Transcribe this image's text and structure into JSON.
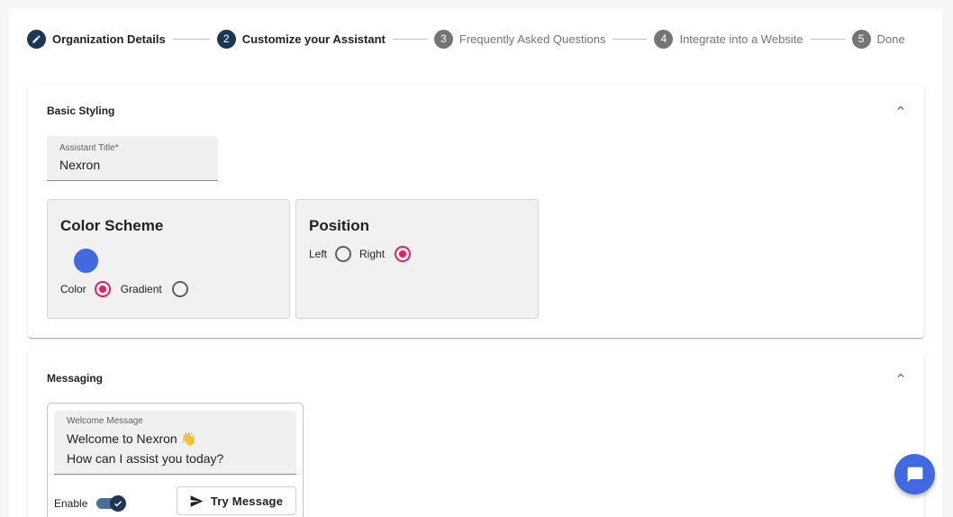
{
  "stepper": {
    "steps": [
      {
        "number": "",
        "label": "Organization Details",
        "state": "completed",
        "icon": "pencil-icon"
      },
      {
        "number": "2",
        "label": "Customize your Assistant",
        "state": "active"
      },
      {
        "number": "3",
        "label": "Frequently Asked Questions",
        "state": "inactive"
      },
      {
        "number": "4",
        "label": "Integrate into a Website",
        "state": "inactive"
      },
      {
        "number": "5",
        "label": "Done",
        "state": "inactive"
      }
    ]
  },
  "basic_styling": {
    "title": "Basic Styling",
    "collapse_icon": "chevron-up-icon",
    "assistant_title": {
      "label": "Assistant Title*",
      "value": "Nexron"
    },
    "color_scheme": {
      "title": "Color Scheme",
      "swatch_color": "#4169e1",
      "options": [
        {
          "label": "Color",
          "checked": true
        },
        {
          "label": "Gradient",
          "checked": false
        }
      ]
    },
    "position": {
      "title": "Position",
      "options": [
        {
          "label": "Left",
          "checked": false
        },
        {
          "label": "Right",
          "checked": true
        }
      ]
    }
  },
  "messaging": {
    "title": "Messaging",
    "collapse_icon": "chevron-up-icon",
    "welcome_message": {
      "label": "Welcome Message",
      "line1": "Welcome to Nexron 👋",
      "line2": "How can I assist you today?"
    },
    "enable_label": "Enable",
    "enabled": true,
    "try_button_label": "Try Message"
  },
  "fab": {
    "icon": "chat-bubble-icon",
    "color": "#4169e1"
  },
  "colors": {
    "primary": "#1d3557",
    "accent_pink": "#e91e63",
    "swatch": "#4169e1"
  }
}
